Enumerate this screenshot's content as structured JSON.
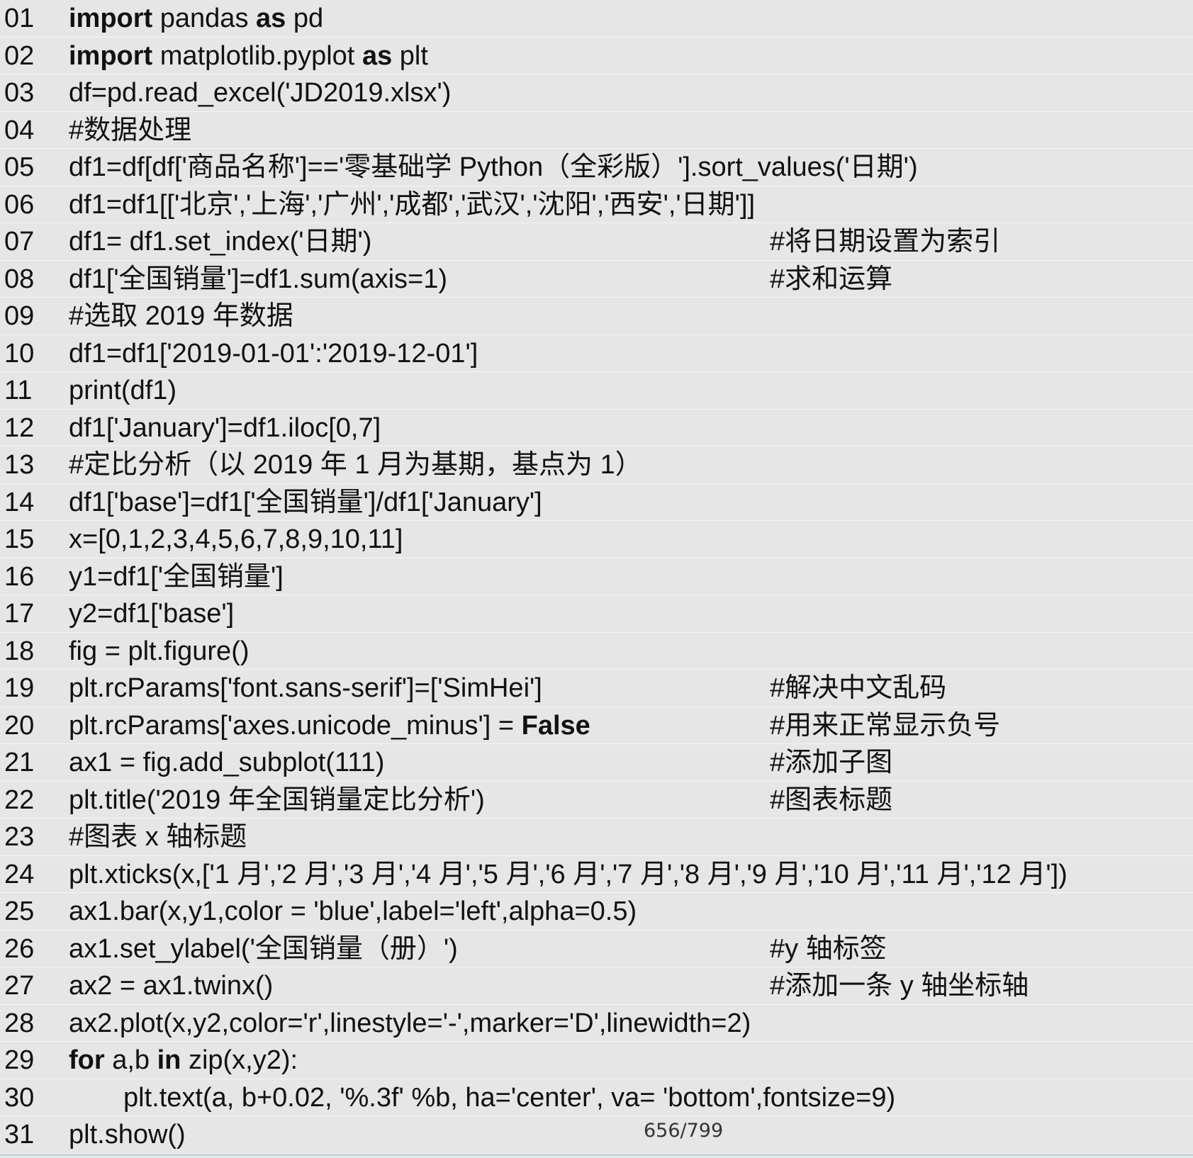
{
  "lines": [
    {
      "n": "01",
      "code": [
        {
          "t": "import",
          "b": true
        },
        {
          "t": " pandas "
        },
        {
          "t": "as",
          "b": true
        },
        {
          "t": " pd"
        }
      ],
      "comment": ""
    },
    {
      "n": "02",
      "code": [
        {
          "t": "import",
          "b": true
        },
        {
          "t": " matplotlib.pyplot "
        },
        {
          "t": "as",
          "b": true
        },
        {
          "t": " plt"
        }
      ],
      "comment": ""
    },
    {
      "n": "03",
      "code": [
        {
          "t": "df=pd.read_excel('JD2019.xlsx')"
        }
      ],
      "comment": ""
    },
    {
      "n": "04",
      "code": [
        {
          "t": "#数据处理"
        }
      ],
      "comment": ""
    },
    {
      "n": "05",
      "code": [
        {
          "t": "df1=df[df['商品名称']=='零基础学 Python（全彩版）'].sort_values('日期')"
        }
      ],
      "comment": ""
    },
    {
      "n": "06",
      "code": [
        {
          "t": "df1=df1[['北京','上海','广州','成都','武汉','沈阳','西安','日期']]"
        }
      ],
      "comment": ""
    },
    {
      "n": "07",
      "code": [
        {
          "t": "df1= df1.set_index('日期')"
        }
      ],
      "comment": "#将日期设置为索引"
    },
    {
      "n": "08",
      "code": [
        {
          "t": "df1['全国销量']=df1.sum(axis=1)"
        }
      ],
      "comment": "#求和运算"
    },
    {
      "n": "09",
      "code": [
        {
          "t": "#选取 2019 年数据"
        }
      ],
      "comment": ""
    },
    {
      "n": "10",
      "code": [
        {
          "t": "df1=df1['2019-01-01':'2019-12-01']"
        }
      ],
      "comment": ""
    },
    {
      "n": "11",
      "code": [
        {
          "t": "print(df1)"
        }
      ],
      "comment": ""
    },
    {
      "n": "12",
      "code": [
        {
          "t": "df1['January']=df1.iloc[0,7]"
        }
      ],
      "comment": ""
    },
    {
      "n": "13",
      "code": [
        {
          "t": "#定比分析（以 2019 年 1 月为基期，基点为 1）"
        }
      ],
      "comment": ""
    },
    {
      "n": "14",
      "code": [
        {
          "t": "df1['base']=df1['全国销量']/df1['January']"
        }
      ],
      "comment": ""
    },
    {
      "n": "15",
      "code": [
        {
          "t": "x=[0,1,2,3,4,5,6,7,8,9,10,11]"
        }
      ],
      "comment": ""
    },
    {
      "n": "16",
      "code": [
        {
          "t": "y1=df1['全国销量']"
        }
      ],
      "comment": ""
    },
    {
      "n": "17",
      "code": [
        {
          "t": "y2=df1['base']"
        }
      ],
      "comment": ""
    },
    {
      "n": "18",
      "code": [
        {
          "t": "fig = plt.figure()"
        }
      ],
      "comment": ""
    },
    {
      "n": "19",
      "code": [
        {
          "t": "plt.rcParams['font.sans-serif']=['SimHei']"
        }
      ],
      "comment": "#解决中文乱码"
    },
    {
      "n": "20",
      "code": [
        {
          "t": "plt.rcParams['axes.unicode_minus'] = "
        },
        {
          "t": "False",
          "b": true
        }
      ],
      "comment": "#用来正常显示负号"
    },
    {
      "n": "21",
      "code": [
        {
          "t": "ax1 = fig.add_subplot(111)"
        }
      ],
      "comment": "#添加子图"
    },
    {
      "n": "22",
      "code": [
        {
          "t": "plt.title('2019 年全国销量定比分析')"
        }
      ],
      "comment": "#图表标题"
    },
    {
      "n": "23",
      "code": [
        {
          "t": "#图表 x 轴标题"
        }
      ],
      "comment": ""
    },
    {
      "n": "24",
      "code": [
        {
          "t": "plt.xticks(x,['1 月','2 月','3 月','4 月','5 月','6 月','7 月','8 月','9 月','10 月','11 月','12 月'])"
        }
      ],
      "comment": ""
    },
    {
      "n": "25",
      "code": [
        {
          "t": "ax1.bar(x,y1,color = 'blue',label='left',alpha=0.5)"
        }
      ],
      "comment": ""
    },
    {
      "n": "26",
      "code": [
        {
          "t": "ax1.set_ylabel('全国销量（册）')"
        }
      ],
      "comment": "#y 轴标签"
    },
    {
      "n": "27",
      "code": [
        {
          "t": "ax2 = ax1.twinx()"
        }
      ],
      "comment": "#添加一条 y 轴坐标轴"
    },
    {
      "n": "28",
      "code": [
        {
          "t": "ax2.plot(x,y2,color='r',linestyle='-',marker='D',linewidth=2)"
        }
      ],
      "comment": ""
    },
    {
      "n": "29",
      "code": [
        {
          "t": "for",
          "b": true
        },
        {
          "t": " a,b "
        },
        {
          "t": "in",
          "b": true
        },
        {
          "t": " zip(x,y2):"
        }
      ],
      "comment": ""
    },
    {
      "n": "30",
      "code": [
        {
          "t": "plt.text(a, b+0.02, '%.3f' %b, ha='center', va= 'bottom',fontsize=9)"
        }
      ],
      "comment": "",
      "indent": true
    },
    {
      "n": "31",
      "code": [
        {
          "t": "plt.show()"
        }
      ],
      "comment": ""
    }
  ],
  "page_number": "656/799"
}
